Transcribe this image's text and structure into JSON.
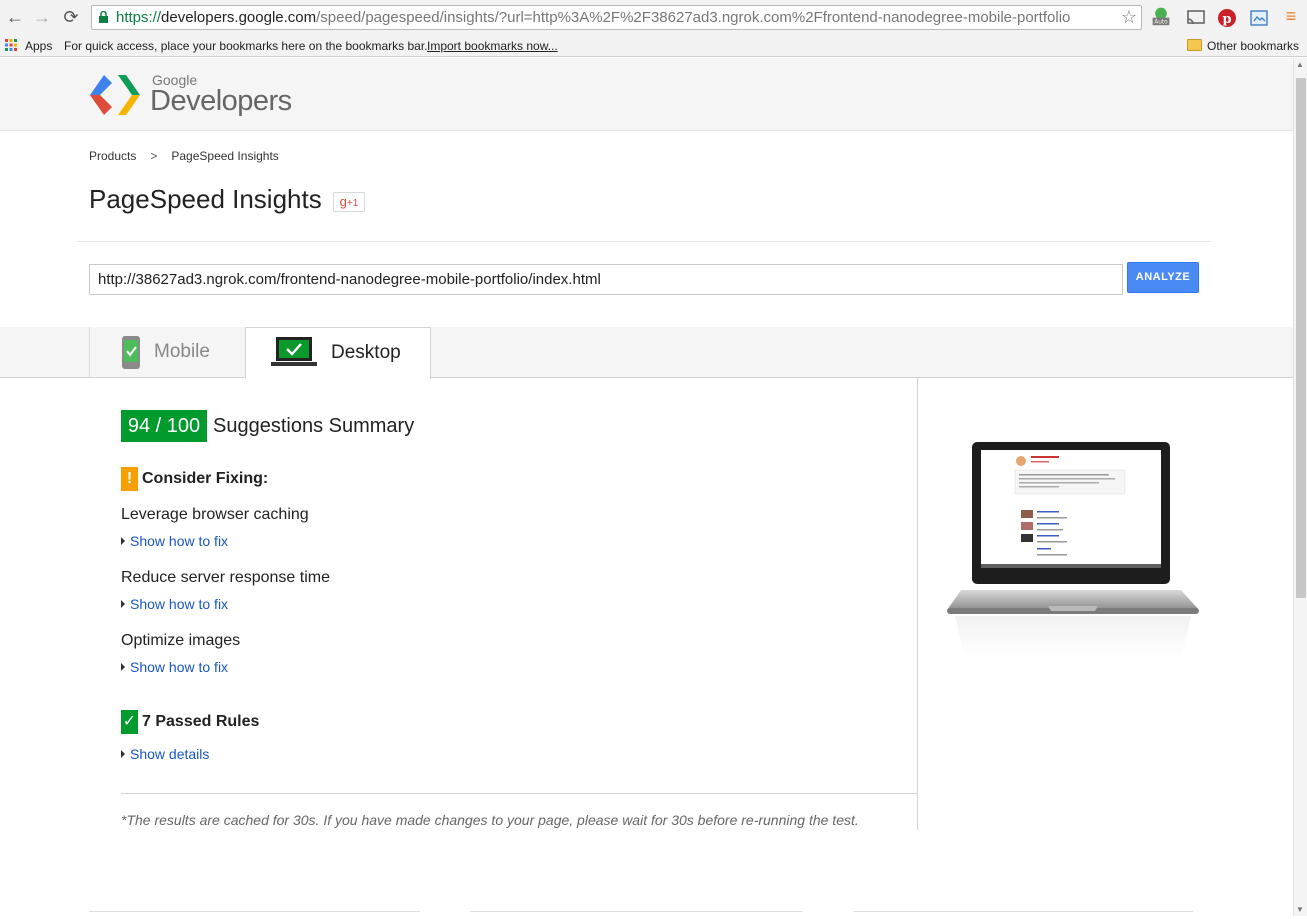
{
  "browser": {
    "back_icon": "←",
    "forward_icon": "→",
    "reload_icon": "⟳",
    "url_scheme": "https://",
    "url_host": "developers.google.com",
    "url_path": "/speed/pagespeed/insights/?url=http%3A%2F%2F38627ad3.ngrok.com%2Ffrontend-nanodegree-mobile-portfolio",
    "star_icon": "☆",
    "menu_icon": "≡"
  },
  "bookmarks": {
    "apps_label": "Apps",
    "hint": "For quick access, place your bookmarks here on the bookmarks bar.",
    "import_link": "Import bookmarks now...",
    "other_label": "Other bookmarks"
  },
  "site": {
    "brand_small": "Google",
    "brand_large": "Developers"
  },
  "breadcrumb": {
    "item1": "Products",
    "separator": ">",
    "item2": "PageSpeed Insights"
  },
  "title": "PageSpeed Insights",
  "plus_one": {
    "g": "g",
    "count": "+1"
  },
  "url_field": {
    "value": "http://38627ad3.ngrok.com/frontend-nanodegree-mobile-portfolio/index.html"
  },
  "analyze_label": "ANALYZE",
  "tabs": {
    "mobile": "Mobile",
    "desktop": "Desktop",
    "selected": "Desktop"
  },
  "summary": {
    "score": "94 / 100",
    "heading": "Suggestions Summary",
    "consider_icon": "!",
    "consider_heading": "Consider Fixing:",
    "rules": [
      {
        "title": "Leverage browser caching",
        "link": "Show how to fix"
      },
      {
        "title": "Reduce server response time",
        "link": "Show how to fix"
      },
      {
        "title": "Optimize images",
        "link": "Show how to fix"
      }
    ],
    "passed_icon": "✓",
    "passed_heading": "7 Passed Rules",
    "passed_link": "Show details",
    "cache_note": "*The results are cached for 30s. If you have made changes to your page, please wait for 30s before re-running the test."
  },
  "colors": {
    "score_green": "#009a2d",
    "warning_orange": "#f5a000",
    "link_blue": "#1a56c5",
    "analyze_blue": "#4a8af4"
  }
}
